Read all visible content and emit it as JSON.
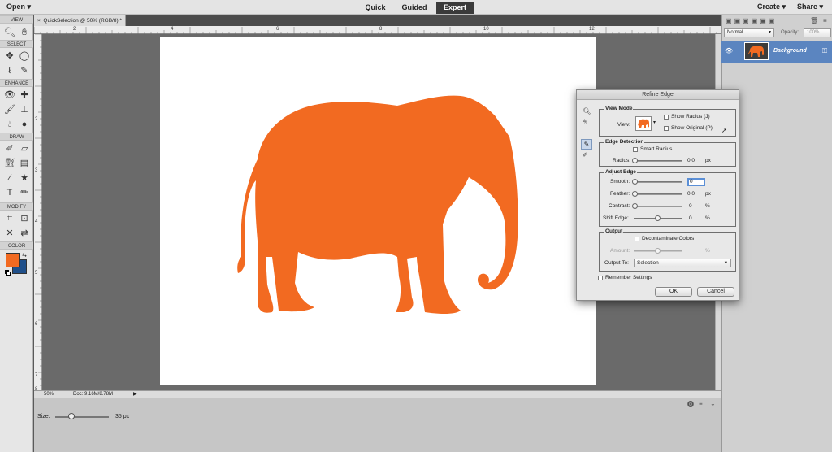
{
  "menubar": {
    "open": "Open",
    "modes": [
      "Quick",
      "Guided",
      "Expert"
    ],
    "create": "Create",
    "share": "Share"
  },
  "toolbox": {
    "sections": [
      "VIEW",
      "SELECT",
      "ENHANCE",
      "DRAW",
      "MODIFY",
      "COLOR"
    ],
    "foreground_color": "#f26a21",
    "background_color": "#1f4f8a"
  },
  "document": {
    "tab_title": "QuickSelection @ 50% (RGB/8) *",
    "zoom": "50%",
    "doc_size": "Doc: 9.16M/8.78M"
  },
  "rulers": {
    "top": [
      "2",
      "4",
      "6",
      "8",
      "10",
      "12"
    ],
    "left": [
      "2",
      "3",
      "4",
      "5",
      "6",
      "7",
      "8"
    ]
  },
  "canvas": {
    "subject_color": "#f26a21"
  },
  "options": {
    "size_label": "Size:",
    "size_value": "35 px",
    "size_level": 0.3
  },
  "layers": {
    "blend_mode": "Normal",
    "opacity_label": "Opacity:",
    "opacity_value": "100%",
    "layer_name": "Background"
  },
  "dialog": {
    "title": "Refine Edge",
    "view_mode": {
      "title": "View Mode",
      "view_label": "View:",
      "show_radius": "Show Radius (J)",
      "show_original": "Show Original (P)"
    },
    "edge_detection": {
      "title": "Edge Detection",
      "smart_radius": "Smart Radius",
      "radius_label": "Radius:",
      "radius_value": "0.0",
      "radius_unit": "px"
    },
    "adjust_edge": {
      "title": "Adjust Edge",
      "smooth_label": "Smooth:",
      "smooth_value": "0",
      "feather_label": "Feather:",
      "feather_value": "0.0",
      "feather_unit": "px",
      "contrast_label": "Contrast:",
      "contrast_value": "0",
      "contrast_unit": "%",
      "shift_label": "Shift Edge:",
      "shift_value": "0",
      "shift_unit": "%"
    },
    "output": {
      "title": "Output",
      "decontaminate": "Decontaminate Colors",
      "amount_label": "Amount:",
      "amount_unit": "%",
      "output_to_label": "Output To:",
      "output_to_value": "Selection"
    },
    "remember": "Remember Settings",
    "ok": "OK",
    "cancel": "Cancel"
  }
}
